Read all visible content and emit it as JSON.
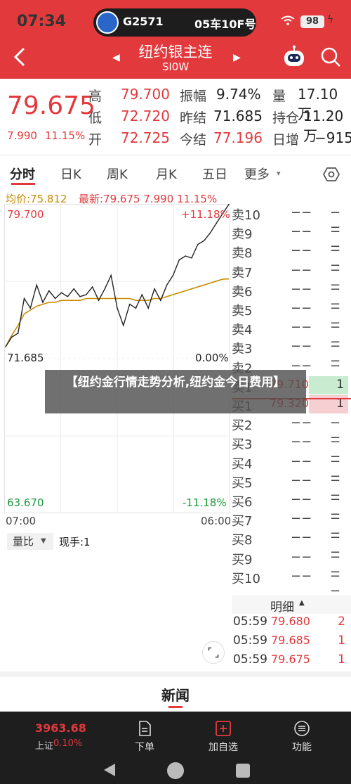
{
  "status": {
    "time": "07:34",
    "train": "G2571",
    "seat": "05车10F号",
    "battery": "98"
  },
  "nav": {
    "title": "纽约银主连",
    "code": "SI0W"
  },
  "quote": {
    "price": "79.675",
    "change": "7.990",
    "change_pct": "11.15%",
    "rows": [
      {
        "l1": "高",
        "v1": "79.700",
        "l2": "振幅",
        "v2": "9.74%",
        "l3": "量",
        "v3": "17.10万"
      },
      {
        "l1": "低",
        "v1": "72.720",
        "l2": "昨结",
        "v2": "71.685",
        "l3": "持仓",
        "v3": "11.20万"
      },
      {
        "l1": "开",
        "v1": "72.725",
        "l2": "今结",
        "v2": "77.196",
        "l3": "日增",
        "v3": "−915"
      }
    ]
  },
  "tabs": [
    "分时",
    "日K",
    "周K",
    "月K",
    "五日",
    "更多"
  ],
  "chart_header": {
    "avg": "均价:75.812",
    "latest": "最新:79.675 7.990 11.15%"
  },
  "chart_data": {
    "type": "line",
    "x_start": "07:00",
    "x_end": "06:00",
    "y_top": "79.700",
    "y_top_pct": "+11.18%",
    "y_mid": "71.685",
    "y_mid_pct": "0.00%",
    "y_bottom": "63.670",
    "y_bottom_pct": "-11.18%",
    "ylim": [
      63.67,
      79.7
    ],
    "price_series": [
      72.3,
      72.8,
      73.0,
      74.8,
      74.3,
      75.5,
      74.6,
      75.2,
      74.8,
      75.1,
      74.9,
      75.3,
      74.9,
      75.0,
      75.4,
      74.7,
      75.3,
      76.0,
      74.3,
      73.4,
      74.5,
      74.3,
      75.0,
      74.3,
      75.3,
      74.7,
      75.5,
      76.0,
      76.8,
      77.0,
      76.9,
      77.6,
      77.8,
      78.2,
      78.7,
      79.2,
      79.675
    ],
    "avg_series": [
      72.3,
      72.9,
      73.4,
      74.0,
      74.2,
      74.4,
      74.5,
      74.6,
      74.6,
      74.7,
      74.7,
      74.7,
      74.7,
      74.8,
      74.8,
      74.8,
      74.8,
      74.8,
      74.8,
      74.8,
      74.8,
      74.7,
      74.7,
      74.7,
      74.8,
      74.8,
      74.9,
      75.0,
      75.1,
      75.2,
      75.3,
      75.4,
      75.5,
      75.6,
      75.7,
      75.8,
      75.812
    ]
  },
  "volume": {
    "dropdown": "量比",
    "current": "现手:1"
  },
  "order_book": {
    "asks": [
      {
        "label": "卖10",
        "price": "−−",
        "vol": "−−"
      },
      {
        "label": "卖9",
        "price": "−−",
        "vol": "−−"
      },
      {
        "label": "卖8",
        "price": "−−",
        "vol": "−−"
      },
      {
        "label": "卖7",
        "price": "−−",
        "vol": "−−"
      },
      {
        "label": "卖6",
        "price": "−−",
        "vol": "−−"
      },
      {
        "label": "卖5",
        "price": "−−",
        "vol": "−−"
      },
      {
        "label": "卖4",
        "price": "−−",
        "vol": "−−"
      },
      {
        "label": "卖3",
        "price": "−−",
        "vol": "−−"
      },
      {
        "label": "卖2",
        "price": "−−",
        "vol": "−−"
      },
      {
        "label": "卖1",
        "price": "79.710",
        "vol": "1"
      }
    ],
    "bids": [
      {
        "label": "买1",
        "price": "79.320",
        "vol": "1"
      },
      {
        "label": "买2",
        "price": "−−",
        "vol": "−−"
      },
      {
        "label": "买3",
        "price": "−−",
        "vol": "−−"
      },
      {
        "label": "买4",
        "price": "−−",
        "vol": "−−"
      },
      {
        "label": "买5",
        "price": "−−",
        "vol": "−−"
      },
      {
        "label": "买6",
        "price": "−−",
        "vol": "−−"
      },
      {
        "label": "买7",
        "price": "−−",
        "vol": "−−"
      },
      {
        "label": "买8",
        "price": "−−",
        "vol": "−−"
      },
      {
        "label": "买9",
        "price": "−−",
        "vol": "−−"
      },
      {
        "label": "买10",
        "price": "−−",
        "vol": "−−"
      }
    ]
  },
  "ticks": {
    "title": "明细",
    "rows": [
      {
        "time": "05:59",
        "price": "79.680",
        "vol": "2"
      },
      {
        "time": "05:59",
        "price": "79.685",
        "vol": "1"
      },
      {
        "time": "05:59",
        "price": "79.675",
        "vol": "1"
      }
    ]
  },
  "banner": "【纽约金行情走势分析,纽约金今日费用】",
  "news_title": "新闻",
  "bottom_bar": {
    "index_value": "3963.68",
    "index_name": "上证",
    "index_pct": "0.10%",
    "items": [
      "下单",
      "加自选",
      "功能"
    ]
  },
  "colors": {
    "brand_red": "#e2393d",
    "avg_line": "#c98c00",
    "ask_bg": "#c9ecd0",
    "bid_bg": "#f6cfd2"
  }
}
